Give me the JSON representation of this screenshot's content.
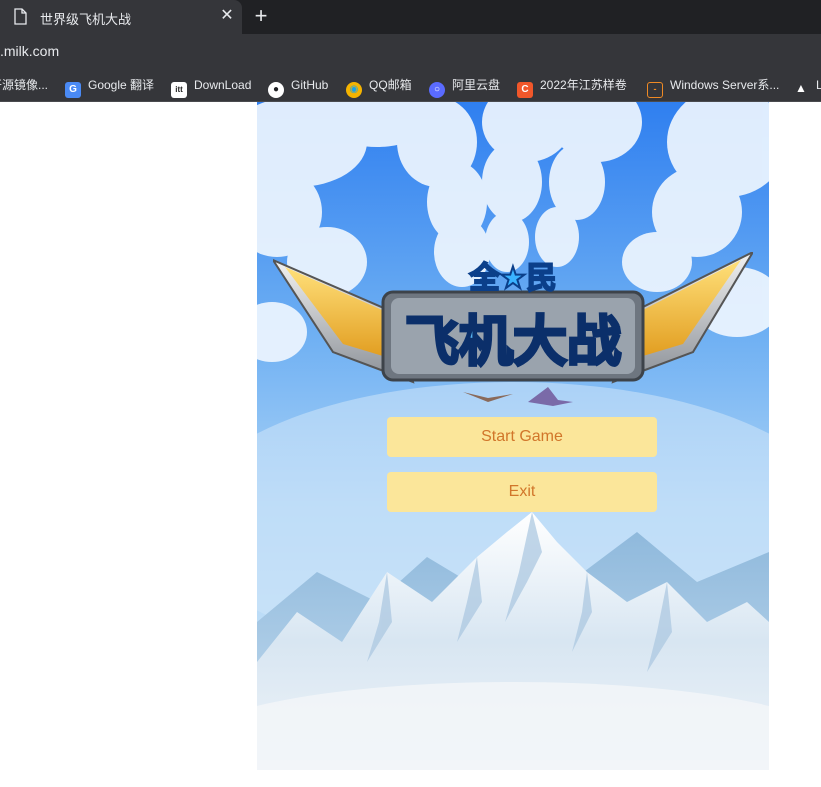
{
  "browser": {
    "tab_title": "世界级飞机大战",
    "tab_close": "✕",
    "new_tab": "+",
    "url": ".milk.com",
    "bookmarks": [
      {
        "label": "开源镜像...",
        "icon": "mirror-icon",
        "color": "#3a3b3f"
      },
      {
        "label": "Google 翻译",
        "icon": "google-translate-icon",
        "color": "#4a8af4"
      },
      {
        "label": "DownLoad",
        "icon": "download-site-icon",
        "color": "#ffffff"
      },
      {
        "label": "GitHub",
        "icon": "github-icon",
        "color": "#ffffff"
      },
      {
        "label": "QQ邮箱",
        "icon": "qq-mail-icon",
        "color": "#f5b400"
      },
      {
        "label": "阿里云盘",
        "icon": "aliyun-drive-icon",
        "color": "#5a6bff"
      },
      {
        "label": "2022年江苏样卷",
        "icon": "c-site-icon",
        "color": "#f1572a"
      },
      {
        "label": "Windows Server系...",
        "icon": "code-brackets-icon",
        "color": "#f08a24"
      },
      {
        "label": "L",
        "icon": "graduation-cap-icon",
        "color": "#ffffff"
      }
    ]
  },
  "game": {
    "logo": {
      "top_text": "全★民",
      "main_text": "飞机大战"
    },
    "start_label": "Start Game",
    "exit_label": "Exit",
    "colors": {
      "button_bg": "#fbe69a",
      "button_text": "#d1762a",
      "sky_top": "#2f7ff0",
      "sky_bottom": "#bfe0f8"
    }
  }
}
